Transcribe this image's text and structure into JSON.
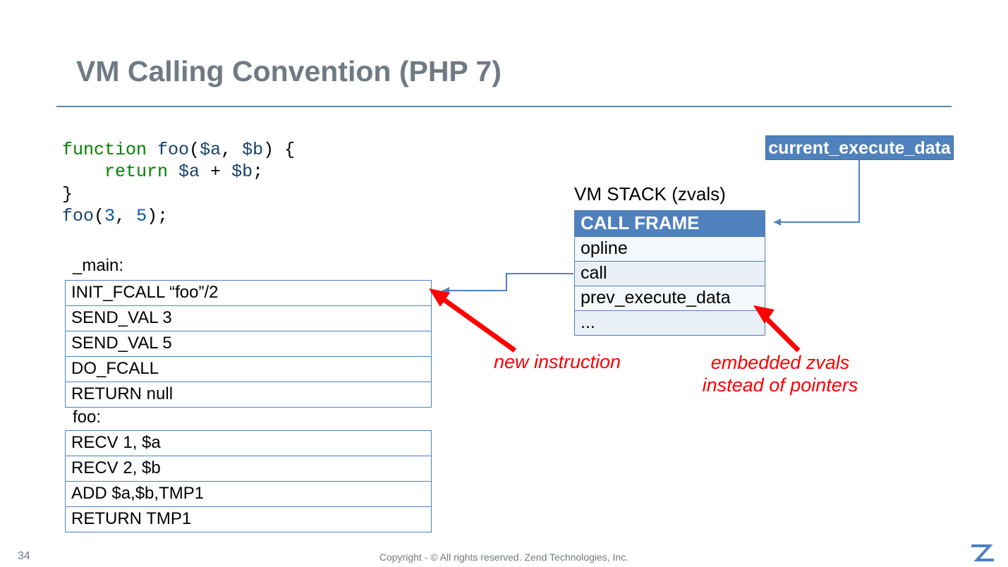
{
  "title": "VM Calling Convention (PHP 7)",
  "code": {
    "l1_kw": "function ",
    "l1_fn": "foo",
    "l1_p1": "(",
    "l1_va": "$a",
    "l1_c1": ", ",
    "l1_vb": "$b",
    "l1_p2": ") {",
    "l2_kw": "    return ",
    "l2_va": "$a ",
    "l2_plus": "+ ",
    "l2_vb": "$b",
    "l2_sc": ";",
    "l3": "}",
    "l4_fn": "foo",
    "l4_p1": "(",
    "l4_a": "3",
    "l4_c": ", ",
    "l4_b": "5",
    "l4_p2": ");"
  },
  "labels": {
    "main": "_main:",
    "foo": "foo:",
    "vm_stack": "VM STACK (zvals)",
    "ced": "current_execute_data"
  },
  "main_ops": [
    "INIT_FCALL  “foo”/2",
    "SEND_VAL 3",
    "SEND_VAL 5",
    "DO_FCALL",
    "RETURN null"
  ],
  "foo_ops": [
    "RECV 1, $a",
    "RECV 2, $b",
    "ADD $a,$b,TMP1",
    "RETURN TMP1"
  ],
  "stack": {
    "header": "CALL FRAME",
    "rows": [
      "opline",
      "call",
      "prev_execute_data",
      "..."
    ]
  },
  "annotations": {
    "new_instruction": "new instruction",
    "embedded_zvals_l1": "embedded zvals",
    "embedded_zvals_l2": "instead of pointers"
  },
  "footer": "Copyright - © All rights reserved. Zend Technologies, Inc.",
  "page": "34"
}
